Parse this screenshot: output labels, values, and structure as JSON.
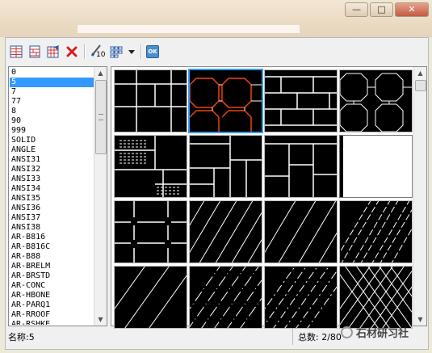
{
  "window": {
    "minimize": "—",
    "restore": "□",
    "close": "✕"
  },
  "toolbar": {
    "buttons": [
      {
        "icon": "hatch-grid-icon"
      },
      {
        "icon": "hatch-page-icon"
      },
      {
        "icon": "hatch-edit-icon"
      },
      {
        "icon": "delete-icon"
      },
      {
        "icon": "brush-icon",
        "label": "10"
      },
      {
        "icon": "view-grid-icon"
      },
      {
        "icon": "dropdown-arrow-icon"
      },
      {
        "icon": "ok-icon",
        "label": "OK"
      }
    ]
  },
  "pattern_list": {
    "selected": "5",
    "items": [
      "0",
      "5",
      "7",
      "77",
      "8",
      "90",
      "999",
      "SOLID",
      "ANGLE",
      "ANSI31",
      "ANSI32",
      "ANSI33",
      "ANSI34",
      "ANSI35",
      "ANSI36",
      "ANSI37",
      "ANSI38",
      "AR-B816",
      "AR-B816C",
      "AR-B88",
      "AR-BRELM",
      "AR-BRSTD",
      "AR-CONC",
      "AR-HBONE",
      "AR-PARQ1",
      "AR-RROOF",
      "AR-RSHKE"
    ]
  },
  "status": {
    "name_label": "名称:5",
    "total_label": "总数: 2/80"
  },
  "watermark": "石材研习社"
}
